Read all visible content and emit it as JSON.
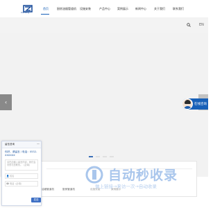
{
  "header": {
    "logo_brand": "Xisheng",
    "nav": [
      "首页",
      "厨房油烟管道机",
      "设施安装",
      "产品中心",
      "案例展示",
      "新闻中心",
      "关于我们",
      "联系我们"
    ],
    "active_index": 0
  },
  "toolbar": {
    "lang": "EN"
  },
  "slider": {
    "prev": "‹",
    "next": "›",
    "dot_count": 4,
    "active_dot": 0
  },
  "consult": {
    "label": "在线咨询"
  },
  "cards": {
    "links": [
      "油烟管道机",
      "厨房管道机",
      "设施安装",
      "案例展示"
    ]
  },
  "chat": {
    "title": "留言咨询",
    "minimize": "—",
    "message": "你好，请留言 / 电话：0532-XXXXXX",
    "textarea_placeholder": "请在此输入留言内容，我们会尽快与您联系。（必填）",
    "name_placeholder": "姓名",
    "phone_placeholder": "电话（必填）",
    "send": "发送"
  },
  "watermark": {
    "title": "自动秒收录",
    "subtitle": "做上链接→来访一次→自动收录"
  }
}
